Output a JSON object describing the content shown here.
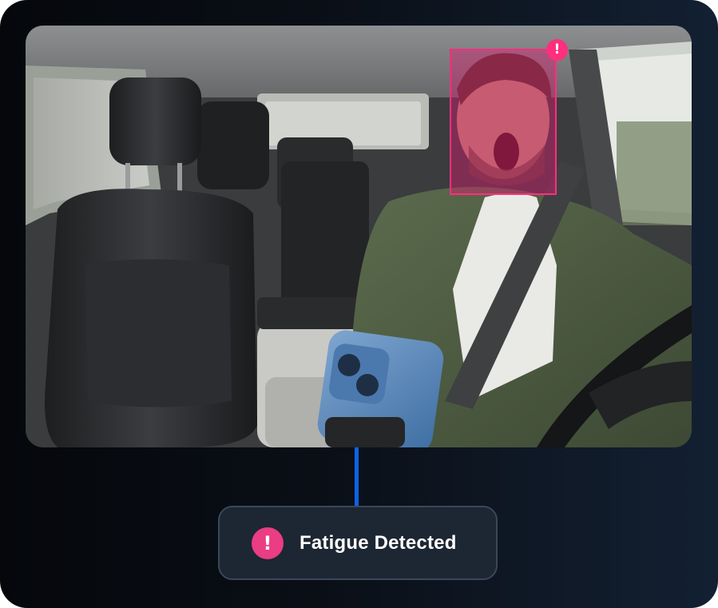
{
  "alert": {
    "label": "Fatigue Detected",
    "icon": "exclamation-icon",
    "symbol": "!"
  },
  "face_detection": {
    "badge_symbol": "!",
    "status": "alert"
  },
  "colors": {
    "accent_pink": "#ea3d83",
    "connector_blue": "#0c63e7",
    "card_background": "#0a0f17"
  }
}
